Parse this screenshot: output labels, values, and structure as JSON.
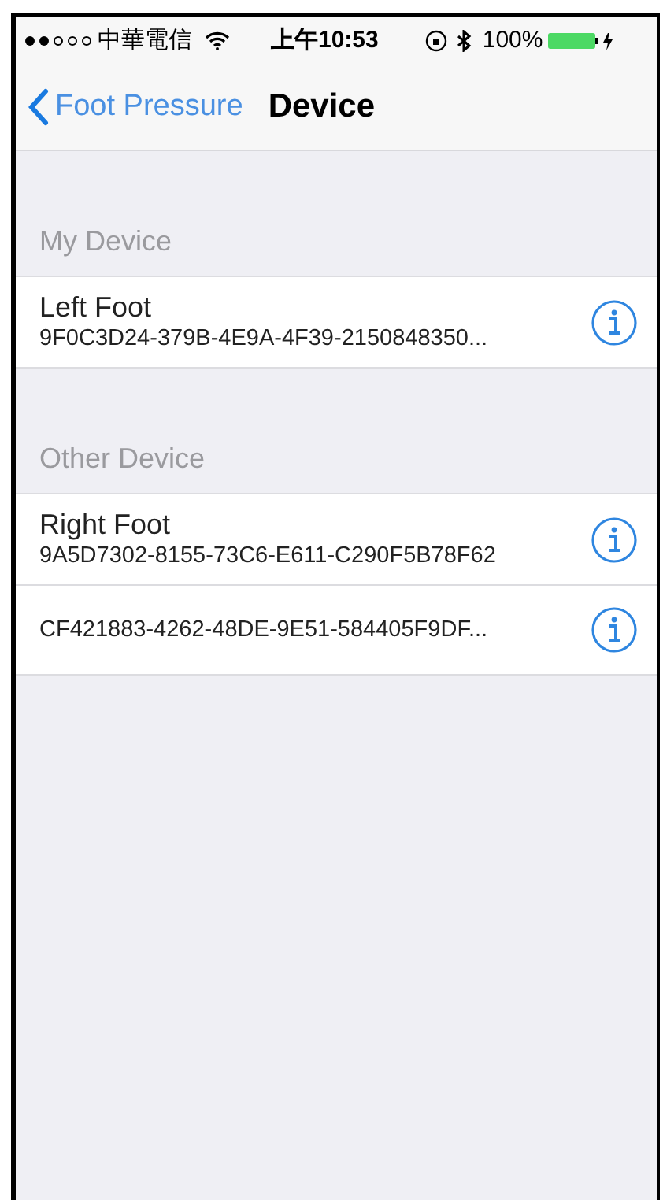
{
  "status_bar": {
    "carrier": "中華電信",
    "time": "上午10:53",
    "battery": "100%"
  },
  "nav": {
    "back": "Foot Pressure",
    "title": "Device"
  },
  "sections": [
    {
      "header": "My Device",
      "rows": [
        {
          "kind": "named",
          "name": "Left Foot",
          "id": "9F0C3D24-379B-4E9A-4F39-2150848350..."
        }
      ]
    },
    {
      "header": "Other Device",
      "rows": [
        {
          "kind": "named",
          "name": "Right Foot",
          "id": "9A5D7302-8155-73C6-E611-C290F5B78F62"
        },
        {
          "kind": "plain",
          "id": "CF421883-4262-48DE-9E51-584405F9DF..."
        }
      ]
    }
  ]
}
